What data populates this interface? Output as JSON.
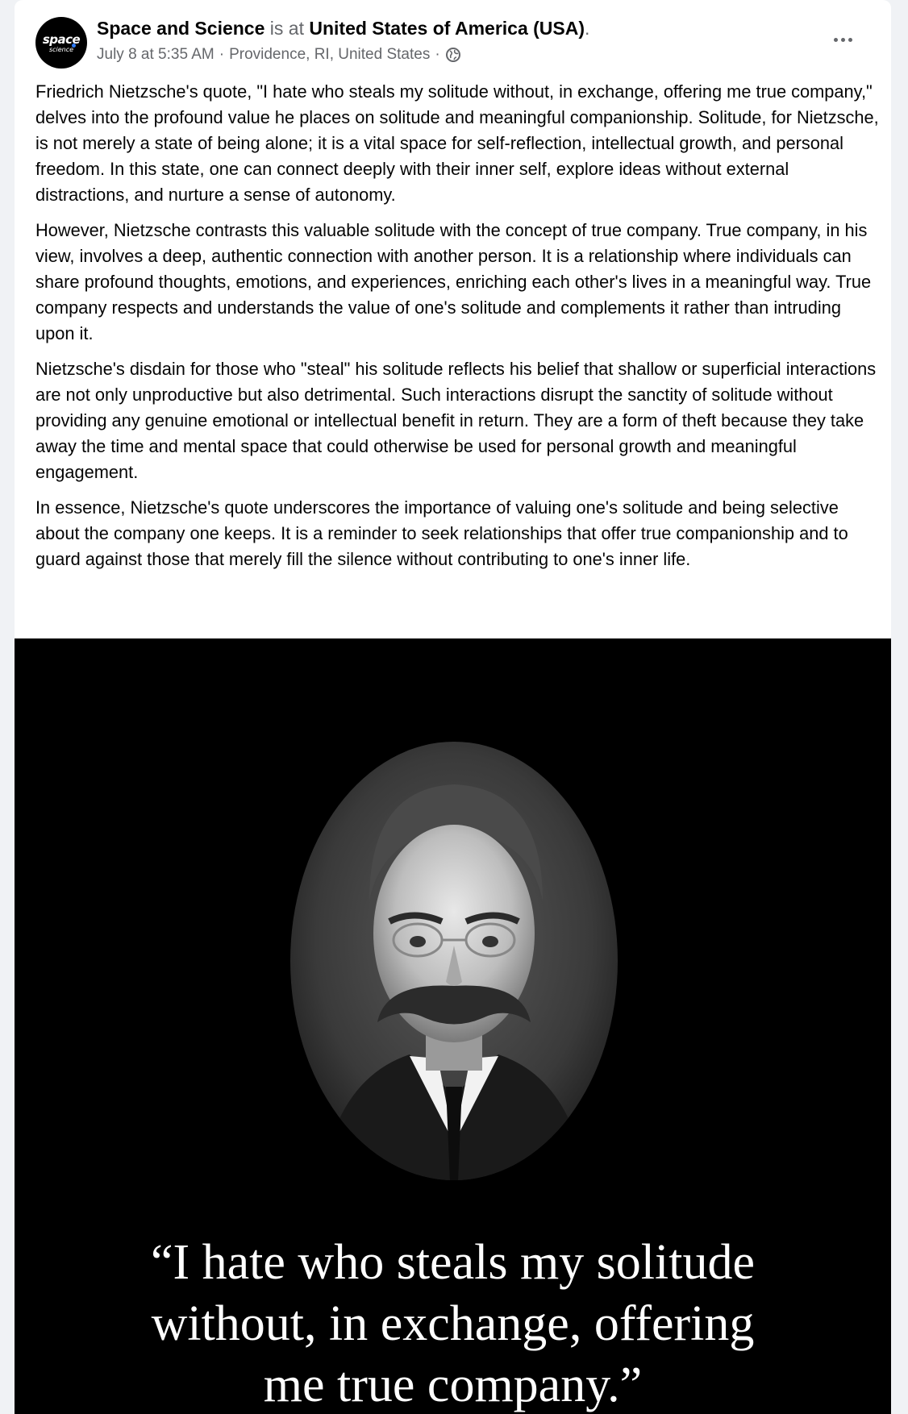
{
  "post": {
    "page_name": "Space and Science",
    "is_at": "is at",
    "location_name": "United States of America (USA)",
    "period": ".",
    "date": "July 8 at 5:35 AM",
    "place": "Providence, RI, United States",
    "separator": "·",
    "avatar_logo_top": "space",
    "avatar_logo_bottom": "science",
    "privacy_icon": "globe-icon",
    "more_icon": "more-options-icon",
    "paragraphs": [
      "Friedrich Nietzsche's quote, \"I hate who steals my solitude without, in exchange, offering me true company,\" delves into the profound value he places on solitude and meaningful companionship. Solitude, for Nietzsche, is not merely a state of being alone; it is a vital space for self-reflection, intellectual growth, and personal freedom. In this state, one can connect deeply with their inner self, explore ideas without external distractions, and nurture a sense of autonomy.",
      "However, Nietzsche contrasts this valuable solitude with the concept of true company. True company, in his view, involves a deep, authentic connection with another person. It is a relationship where individuals can share profound thoughts, emotions, and experiences, enriching each other's lives in a meaningful way. True company respects and understands the value of one's solitude and complements it rather than intruding upon it.",
      "Nietzsche's disdain for those who \"steal\" his solitude reflects his belief that shallow or superficial interactions are not only unproductive but also detrimental. Such interactions disrupt the sanctity of solitude without providing any genuine emotional or intellectual benefit in return. They are a form of theft because they take away the time and mental space that could otherwise be used for personal growth and meaningful engagement.",
      "In essence, Nietzsche's quote underscores the importance of valuing one's solitude and being selective about the company one keeps. It is a reminder to seek relationships that offer true companionship and to guard against those that merely fill the silence without contributing to one's inner life."
    ],
    "image": {
      "quote_lines": [
        "“I hate who steals my solitude",
        "without, in exchange, offering",
        "me true company.”"
      ]
    }
  },
  "colors": {
    "page_bg": "#f0f2f5",
    "card_bg": "#ffffff",
    "text_primary": "#050505",
    "text_secondary": "#65676b",
    "image_bg": "#000000"
  }
}
